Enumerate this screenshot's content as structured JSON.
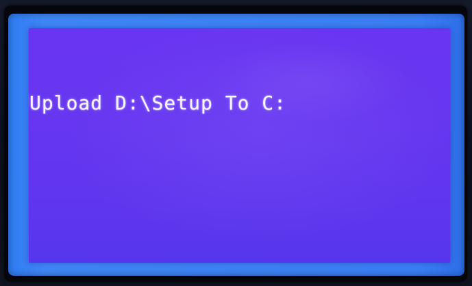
{
  "display": {
    "message": "Upload D:\\Setup To C:"
  },
  "colors": {
    "panel": "#6636f0",
    "frame": "#3a7ef3",
    "text": "#f2f0ff",
    "bezel": "#05060c"
  }
}
